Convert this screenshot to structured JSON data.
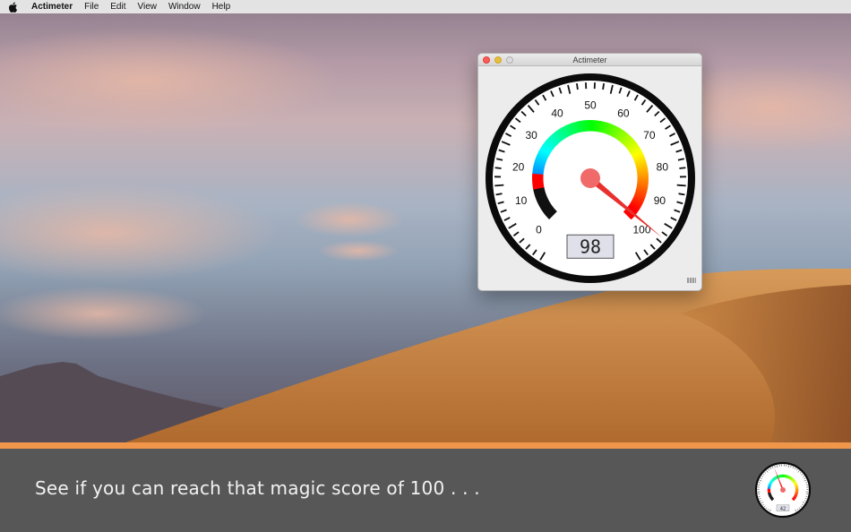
{
  "menubar": {
    "apple_icon": "apple-icon",
    "app_name": "Actimeter",
    "items": [
      "File",
      "Edit",
      "View",
      "Window",
      "Help"
    ]
  },
  "window": {
    "title": "Actimeter",
    "gauge": {
      "min": 0,
      "max": 100,
      "value": 98,
      "display": "98",
      "scale_labels": [
        "0",
        "10",
        "20",
        "30",
        "40",
        "50",
        "60",
        "70",
        "80",
        "90",
        "100"
      ]
    }
  },
  "promo": {
    "tagline": "See if you can reach that magic score of 100 . . .",
    "mini_gauge": {
      "value": 42,
      "display": "42"
    }
  },
  "colors": {
    "accent_stripe": "#f0964a",
    "bottom_bar": "#575757",
    "needle": "#e8302f",
    "hub": "#f06a6a"
  }
}
